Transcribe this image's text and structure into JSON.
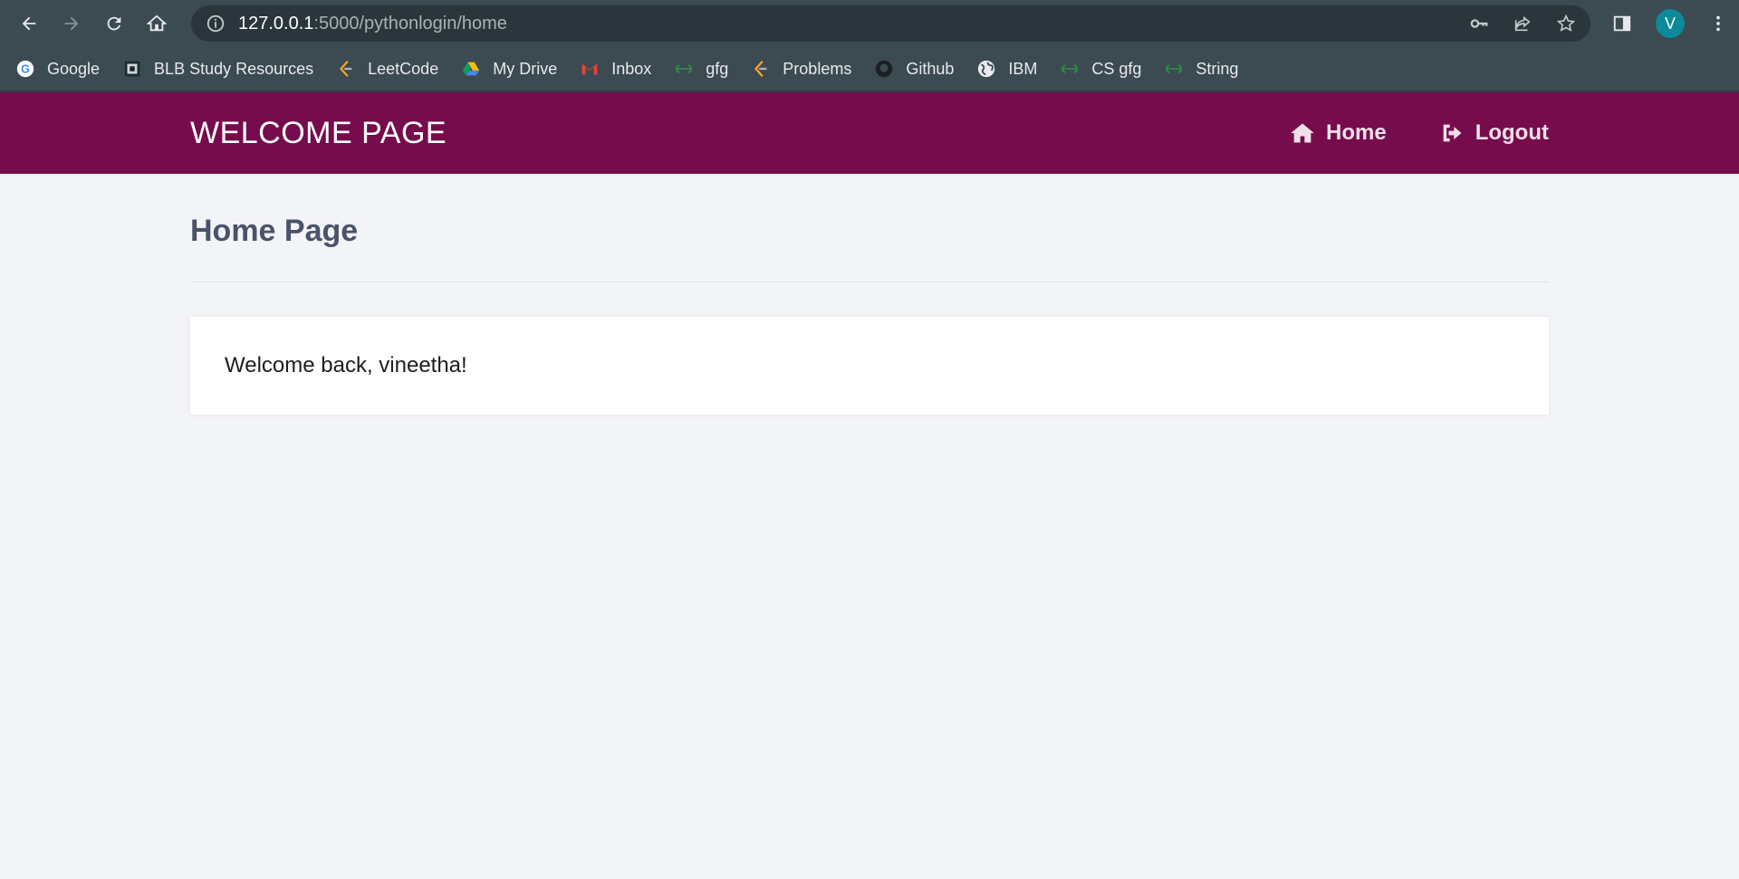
{
  "browser": {
    "url_host": "127.0.0.1",
    "url_rest": ":5000/pythonlogin/home",
    "profile_initial": "V"
  },
  "bookmarks": [
    {
      "label": "Google",
      "icon": "google-icon"
    },
    {
      "label": "BLB Study Resources",
      "icon": "blb-icon"
    },
    {
      "label": "LeetCode",
      "icon": "leetcode-icon"
    },
    {
      "label": "My Drive",
      "icon": "drive-icon"
    },
    {
      "label": "Inbox",
      "icon": "gmail-icon"
    },
    {
      "label": "gfg",
      "icon": "gfg-icon"
    },
    {
      "label": "Problems",
      "icon": "leetcode-icon"
    },
    {
      "label": "Github",
      "icon": "github-icon"
    },
    {
      "label": "IBM",
      "icon": "globe-icon"
    },
    {
      "label": "CS gfg",
      "icon": "gfg-icon"
    },
    {
      "label": "String",
      "icon": "gfg-icon"
    }
  ],
  "app": {
    "brand": "WELCOME PAGE",
    "nav": {
      "home": "Home",
      "logout": "Logout"
    },
    "page_title": "Home Page",
    "welcome": "Welcome back, vineetha!"
  },
  "colors": {
    "navbar": "#760c4c",
    "background": "#f3f4f7",
    "title": "#4a536b"
  }
}
